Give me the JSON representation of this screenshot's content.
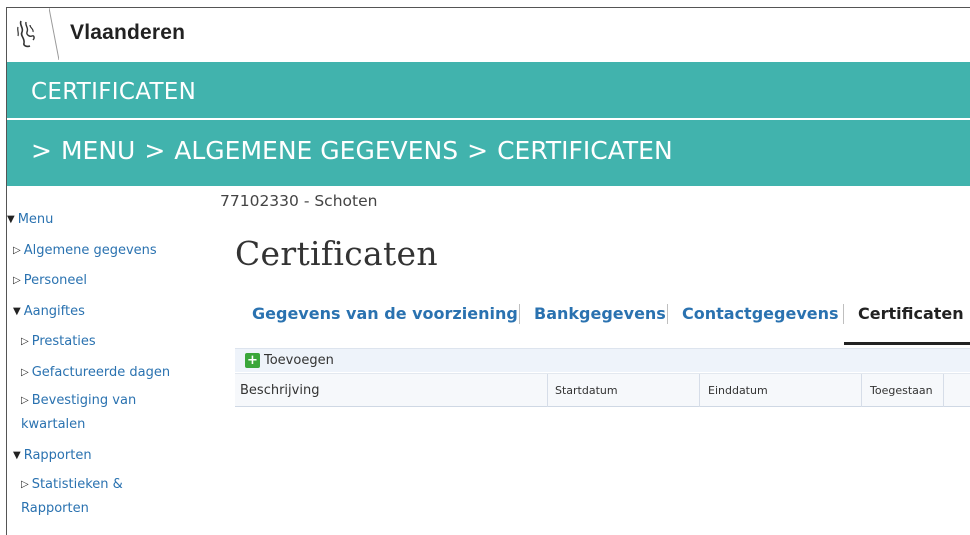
{
  "brand": {
    "name": "Vlaanderen",
    "logo_icon": "flanders-lion-icon"
  },
  "header": {
    "title": "CERTIFICATEN",
    "breadcrumb": [
      ">",
      "MENU",
      ">",
      "ALGEMENE GEGEVENS",
      ">",
      "CERTIFICATEN"
    ],
    "color": "#41b3ad"
  },
  "sidebar": {
    "items": [
      {
        "label": "Menu",
        "expanded": true
      },
      {
        "label": "Algemene gegevens",
        "expanded": false
      },
      {
        "label": "Personeel",
        "expanded": false
      },
      {
        "label": "Aangiftes",
        "expanded": true
      },
      {
        "label": "Prestaties",
        "expanded": false
      },
      {
        "label": "Gefactureerde dagen",
        "expanded": false
      },
      {
        "label": "Bevestiging van kwartalen",
        "expanded": false
      },
      {
        "label": "Rapporten",
        "expanded": true
      },
      {
        "label": "Statistieken & Rapporten",
        "expanded": false
      }
    ]
  },
  "main": {
    "organisation": "77102330 - Schoten",
    "title": "Certificaten",
    "tabs": [
      {
        "label": "Gegevens van de voorziening",
        "active": false
      },
      {
        "label": "Bankgegevens",
        "active": false
      },
      {
        "label": "Contactgegevens",
        "active": false
      },
      {
        "label": "Certificaten",
        "active": true
      }
    ],
    "toolbar": {
      "add_label": "Toevoegen",
      "add_icon": "plus-icon"
    },
    "columns": [
      "Beschrijving",
      "Startdatum",
      "Einddatum",
      "Toegestaan"
    ]
  }
}
